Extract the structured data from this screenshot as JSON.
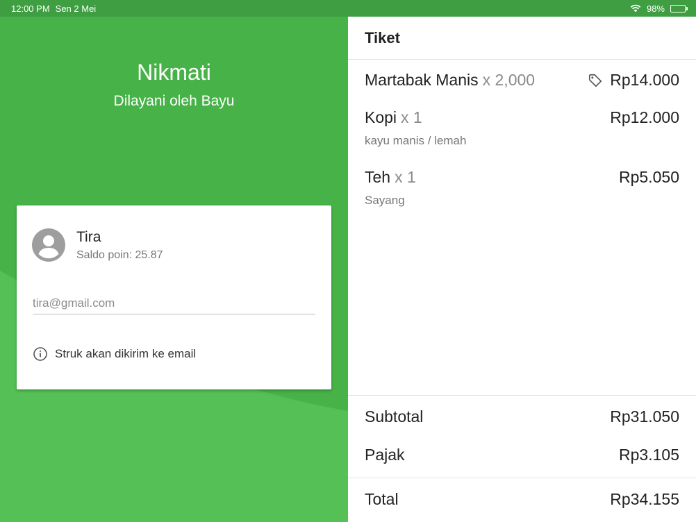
{
  "status_bar": {
    "time": "12:00 PM",
    "date": "Sen 2 Mei",
    "battery": "98%",
    "battery_level": 0.98
  },
  "colors": {
    "primary_green": "#46b247",
    "status_green": "#3f9e41",
    "accent_light_green": "#5cc45d"
  },
  "left": {
    "shop_name": "Nikmati",
    "served_by": "Dilayani oleh Bayu"
  },
  "customer": {
    "name": "Tira",
    "points_label": "Saldo poin: ",
    "points_value": "25.87",
    "email_value": "",
    "email_placeholder": "tira@gmail.com",
    "note": "Struk akan dikirim ke email"
  },
  "ticket": {
    "title": "Tiket",
    "items": [
      {
        "name": "Martabak Manis",
        "qty": "x 2,000",
        "price": "Rp14.000",
        "note": "",
        "discount": true
      },
      {
        "name": "Kopi",
        "qty": "x 1",
        "price": "Rp12.000",
        "note": "kayu manis / lemah"
      },
      {
        "name": "Teh",
        "qty": "x 1",
        "price": "Rp5.050",
        "note": "Sayang"
      }
    ],
    "subtotal_label": "Subtotal",
    "subtotal_value": "Rp31.050",
    "tax_label": "Pajak",
    "tax_value": "Rp3.105",
    "total_label": "Total",
    "total_value": "Rp34.155"
  },
  "icons": [
    "wifi-icon",
    "battery-icon",
    "avatar-icon",
    "info-icon",
    "tag-icon"
  ]
}
